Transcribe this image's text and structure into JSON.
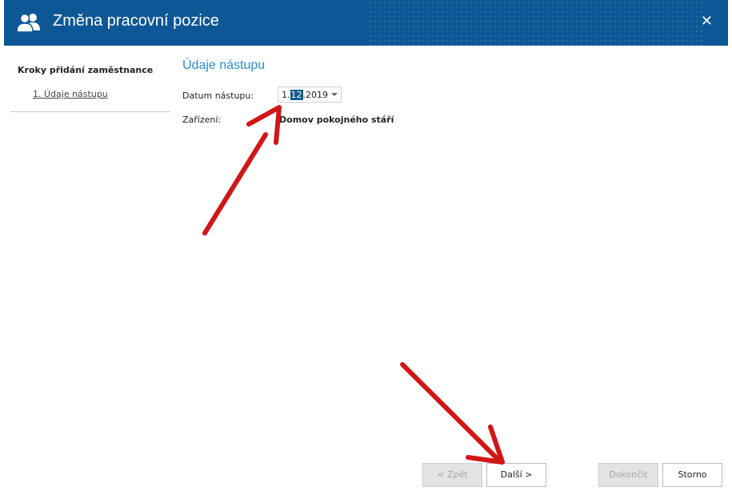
{
  "window": {
    "title": "Změna pracovní pozice",
    "close": "✕"
  },
  "steps": {
    "title": "Kroky přidání zaměstnance",
    "items": [
      {
        "label": "1. Údaje nástupu"
      }
    ]
  },
  "section": {
    "title": "Údaje nástupu"
  },
  "form": {
    "date_label": "Datum nástupu:",
    "date_day": "1.",
    "date_month": "12",
    "date_year": ".2019",
    "facility_label": "Zařízení:",
    "facility_value": "Domov pokojného stáří"
  },
  "buttons": {
    "back": "< Zpět",
    "next": "Další >",
    "finish": "Dokončit",
    "cancel": "Storno"
  },
  "colors": {
    "header": "#0d5796",
    "accent": "#2b8dd4",
    "annotation": "#d11616"
  },
  "icons": {
    "title": "users-icon",
    "close": "close-icon",
    "dropdown": "chevron-down-icon"
  }
}
